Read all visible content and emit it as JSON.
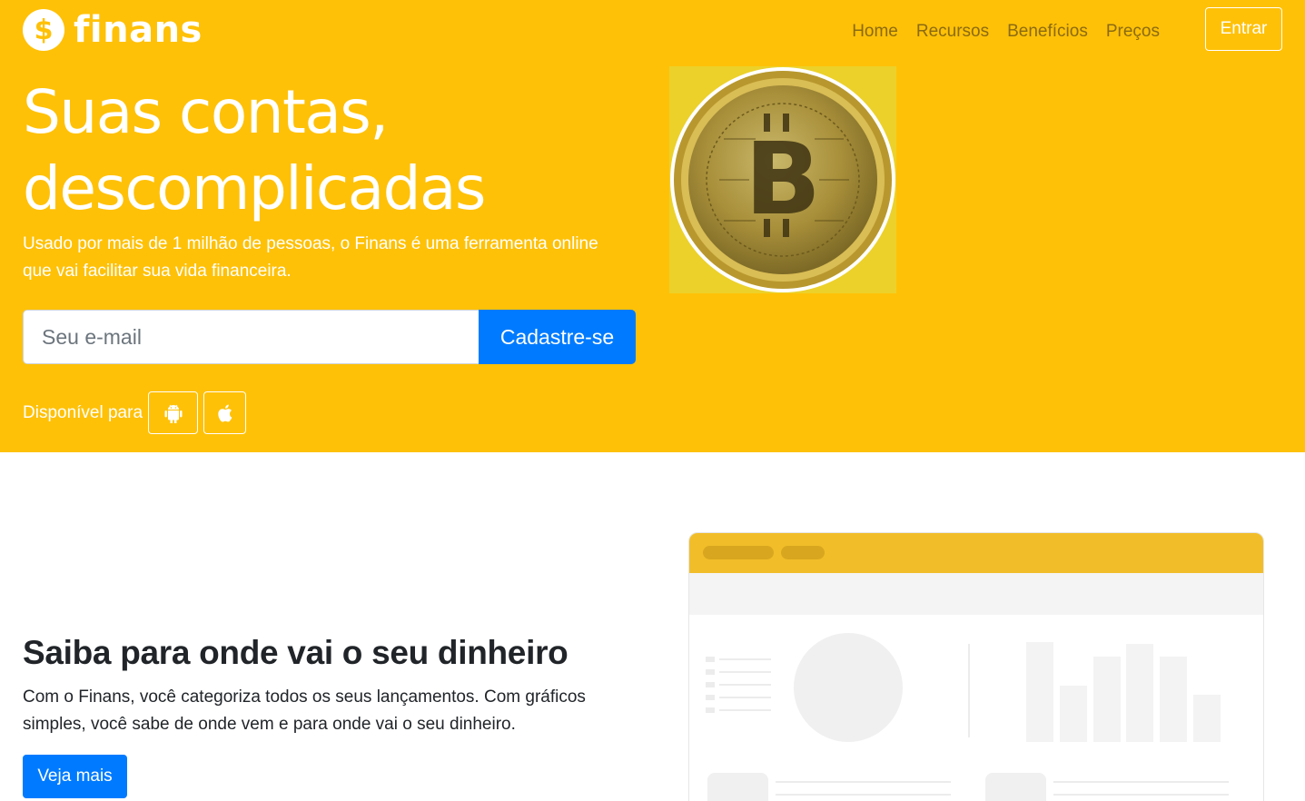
{
  "brand": {
    "name": "finans",
    "icon": "dollar-coin-icon",
    "color": "#ffc107"
  },
  "nav": {
    "links": [
      "Home",
      "Recursos",
      "Benefícios",
      "Preços"
    ],
    "login_label": "Entrar"
  },
  "hero": {
    "title_line1": "Suas contas,",
    "title_line2": "descomplicadas",
    "lead_line1": "Usado por mais de 1 milhão de pessoas, o Finans é uma ferramenta online",
    "lead_line2": "que vai facilitar sua vida financeira.",
    "email_placeholder": "Seu e-mail",
    "signup_label": "Cadastre-se",
    "available_label": "Disponível para",
    "stores": [
      {
        "icon": "android-icon"
      },
      {
        "icon": "apple-icon"
      }
    ],
    "image": "bitcoin-coin-image"
  },
  "feature": {
    "title": "Saiba para onde vai o seu dinheiro",
    "text_line1": "Com o Finans, você categoriza todos os seus lançamentos. Com gráficos",
    "text_line2": "simples, você sabe de onde vem e para onde vai o seu dinheiro.",
    "cta_label": "Veja mais",
    "illustration": "dashboard-mockup"
  },
  "colors": {
    "hero_bg": "#ffc107",
    "primary": "#007bff",
    "mockup_header": "#f1be2a"
  }
}
